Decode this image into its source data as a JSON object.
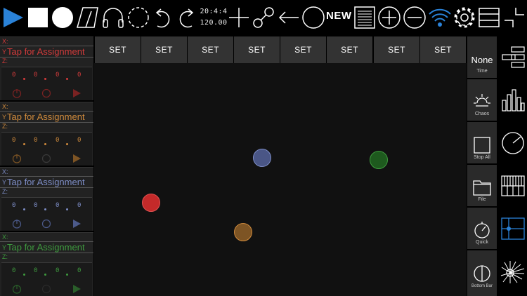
{
  "toolbar": {
    "clock_time": "20:4:4",
    "tempo": "120.00",
    "new_label": "NEW"
  },
  "colors": {
    "accent_blue": "#2a82d8",
    "channel_red": "#d23b3b",
    "channel_orange": "#cf8a3c",
    "channel_blue": "#7d8dc6",
    "channel_green": "#3e9a3e"
  },
  "channels": [
    {
      "x_label": "X:",
      "y_label": "Y",
      "assignment": "Tap for Assignment",
      "z_label": "Z:",
      "values": [
        "0",
        "0",
        "0",
        "0"
      ],
      "color": "#d23b3b"
    },
    {
      "x_label": "X:",
      "y_label": "Y",
      "assignment": "Tap for Assignment",
      "z_label": "Z:",
      "values": [
        "0",
        "0",
        "0",
        "0"
      ],
      "color": "#cf8a3c"
    },
    {
      "x_label": "X:",
      "y_label": "Y",
      "assignment": "Tap for Assignment",
      "z_label": "Z:",
      "values": [
        "0",
        "0",
        "0",
        "0"
      ],
      "color": "#7d8dc6"
    },
    {
      "x_label": "X:",
      "y_label": "Y",
      "assignment": "Tap for Assignment",
      "z_label": "Z:",
      "values": [
        "0",
        "0",
        "0",
        "0"
      ],
      "color": "#3e9a3e"
    }
  ],
  "set_buttons": [
    "SET",
    "SET",
    "SET",
    "SET",
    "SET",
    "SET",
    "SET",
    "SET"
  ],
  "side_buttons": {
    "time_value": "None",
    "time_label": "Time",
    "chaos_label": "Chaos",
    "stop_all_label": "Stop All",
    "file_label": "File",
    "quick_label": "Quick",
    "bottom_bar_label": "Bottom Bar"
  }
}
